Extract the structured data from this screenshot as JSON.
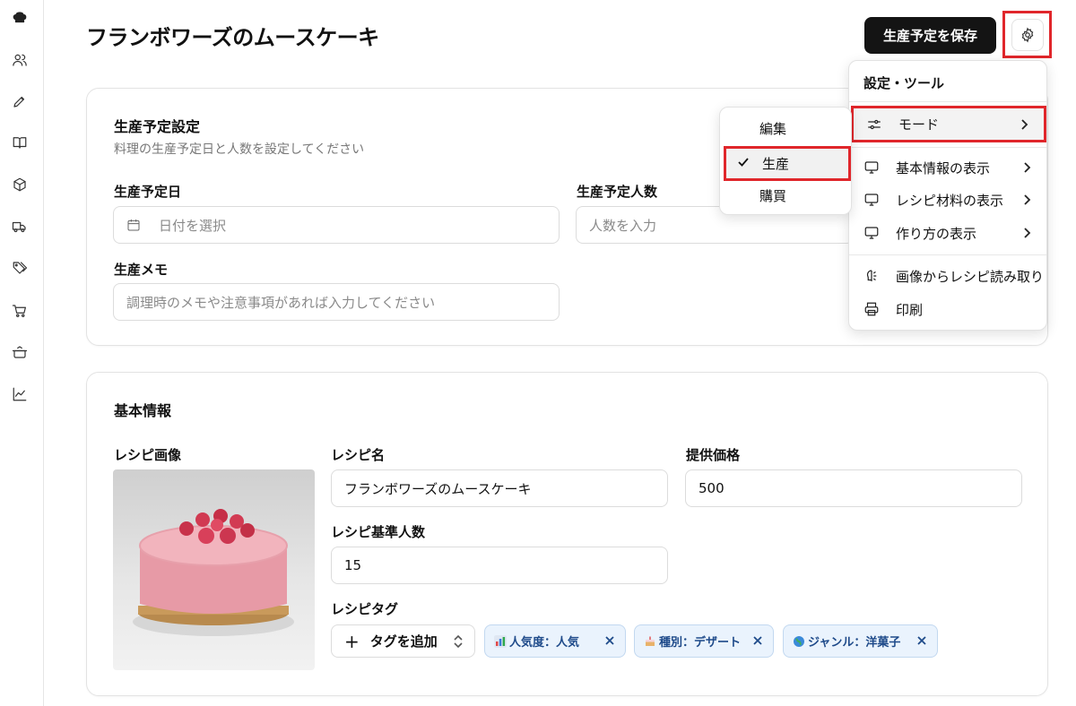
{
  "header": {
    "title": "フランボワーズのムースケーキ",
    "save_label": "生産予定を保存"
  },
  "sidebar": {
    "icons": [
      "chef-hat-icon",
      "users-icon",
      "pen-icon",
      "book-icon",
      "box-icon",
      "truck-icon",
      "tags-icon",
      "cart-icon",
      "pot-icon",
      "chart-icon"
    ]
  },
  "production": {
    "title": "生産予定設定",
    "subtitle": "料理の生産予定日と人数を設定してください",
    "date_label": "生産予定日",
    "date_placeholder": "日付を選択",
    "count_label": "生産予定人数",
    "count_placeholder": "人数を入力",
    "memo_label": "生産メモ",
    "memo_placeholder": "調理時のメモや注意事項があれば入力してください"
  },
  "basic": {
    "title": "基本情報",
    "image_label": "レシピ画像",
    "name_label": "レシピ名",
    "name_value": "フランボワーズのムースケーキ",
    "price_label": "提供価格",
    "price_value": "500",
    "servings_label": "レシピ基準人数",
    "servings_value": "15",
    "tags_label": "レシピタグ",
    "add_tag_label": "タグを追加",
    "tags": [
      {
        "label": "人気度：人気",
        "icon": "bar-chart-emoji"
      },
      {
        "label": "種別：デザート",
        "icon": "cake-emoji"
      },
      {
        "label": "ジャンル：洋菓子",
        "icon": "globe-emoji"
      }
    ]
  },
  "menu": {
    "title": "設定・ツール",
    "items": [
      {
        "label": "モード",
        "icon": "sliders-icon",
        "submenu": true
      },
      {
        "label": "基本情報の表示",
        "icon": "monitor-icon",
        "submenu": true
      },
      {
        "label": "レシピ材料の表示",
        "icon": "monitor-icon",
        "submenu": true
      },
      {
        "label": "作り方の表示",
        "icon": "monitor-icon",
        "submenu": true
      },
      {
        "label": "画像からレシピ読み取り",
        "icon": "scan-icon",
        "submenu": false
      },
      {
        "label": "印刷",
        "icon": "printer-icon",
        "submenu": false
      }
    ]
  },
  "mode_submenu": {
    "items": [
      {
        "label": "編集",
        "checked": false
      },
      {
        "label": "生産",
        "checked": true
      },
      {
        "label": "購買",
        "checked": false
      }
    ]
  },
  "colors": {
    "accent_dark": "#141414",
    "highlight_red": "#e0262b",
    "tag_bg": "#eaf3fd",
    "tag_text": "#1e4a8a"
  }
}
